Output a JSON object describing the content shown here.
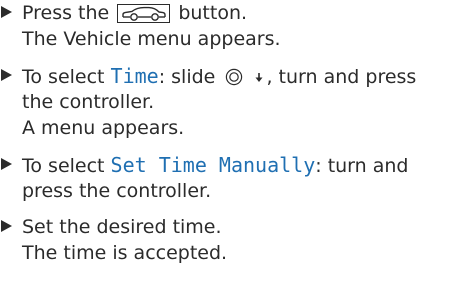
{
  "steps": [
    {
      "line1_pre": "Press the",
      "button_icon": "car-icon",
      "line1_post": "button.",
      "result": "The Vehicle menu appears."
    },
    {
      "line1_pre": "To select",
      "menu_item": "Time",
      "line1_mid": ": slide",
      "controller_icon": "controller-icon",
      "direction_icon": "down-arrow-icon",
      "line1_post": ", turn and press",
      "line2": "the controller.",
      "result": "A menu appears."
    },
    {
      "line1_pre": "To select",
      "menu_item": "Set Time Manually",
      "line1_post": ": turn and",
      "line2": "press the controller."
    },
    {
      "text": "Set the desired time.",
      "result": "The time is accepted."
    }
  ],
  "colors": {
    "text": "#2b2b2b",
    "menu_item": "#1f6fb2"
  }
}
